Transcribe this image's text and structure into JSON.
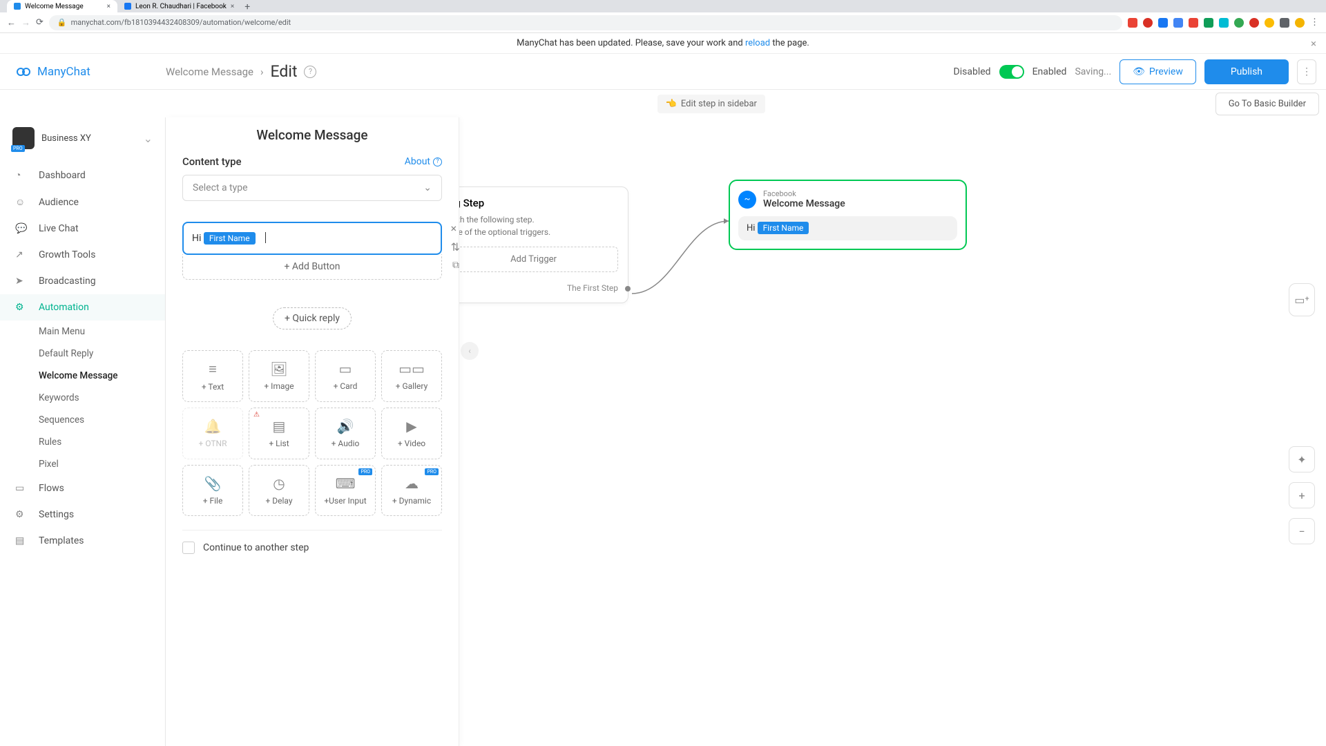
{
  "chrome": {
    "tabs": [
      {
        "title": "Welcome Message"
      },
      {
        "title": "Leon R. Chaudhari | Facebook"
      }
    ],
    "url": "manychat.com/fb181039443240830­9/automation/welcome/edit"
  },
  "notice": {
    "prefix": "ManyChat has been updated. Please, save your work and ",
    "link": "reload",
    "suffix": " the page."
  },
  "brand": "ManyChat",
  "breadcrumb": {
    "parent": "Welcome Message",
    "current": "Edit"
  },
  "header": {
    "disabled": "Disabled",
    "enabled": "Enabled",
    "saving": "Saving...",
    "preview": "Preview",
    "publish": "Publish"
  },
  "subbar": {
    "editStep": "Edit step in sidebar",
    "goBasic": "Go To Basic Builder"
  },
  "account": {
    "name": "Business XY"
  },
  "nav": {
    "dashboard": "Dashboard",
    "audience": "Audience",
    "livechat": "Live Chat",
    "growth": "Growth Tools",
    "broadcasting": "Broadcasting",
    "automation": "Automation",
    "flows": "Flows",
    "settings": "Settings",
    "templates": "Templates",
    "sub": {
      "mainmenu": "Main Menu",
      "default": "Default Reply",
      "welcome": "Welcome Message",
      "keywords": "Keywords",
      "sequences": "Sequences",
      "rules": "Rules",
      "pixel": "Pixel"
    }
  },
  "editor": {
    "title": "Welcome Message",
    "contentType": "Content type",
    "about": "About",
    "selectType": "Select a type",
    "msgPrefix": "Hi ",
    "varChip": "First Name",
    "addButton": "+ Add Button",
    "quickReply": "+ Quick reply",
    "continue": "Continue to another step",
    "blocks": {
      "text": "+ Text",
      "image": "+ Image",
      "card": "+ Card",
      "gallery": "+ Gallery",
      "otnr": "+ OTNR",
      "list": "+ List",
      "audio": "+ Audio",
      "video": "+ Video",
      "file": "+ File",
      "delay": "+ Delay",
      "userinput": "+User Input",
      "dynamic": "+ Dynamic"
    }
  },
  "canvas": {
    "startTitle": "ng Step",
    "startDesc1": "with the following step.",
    "startDesc2": "one of the optional triggers.",
    "addTrigger": "Add Trigger",
    "firstStep": "The First Step",
    "nodeSub": "Facebook",
    "nodeTitle": "Welcome Message",
    "bubblePrefix": "Hi ",
    "bubbleChip": "First Name"
  }
}
